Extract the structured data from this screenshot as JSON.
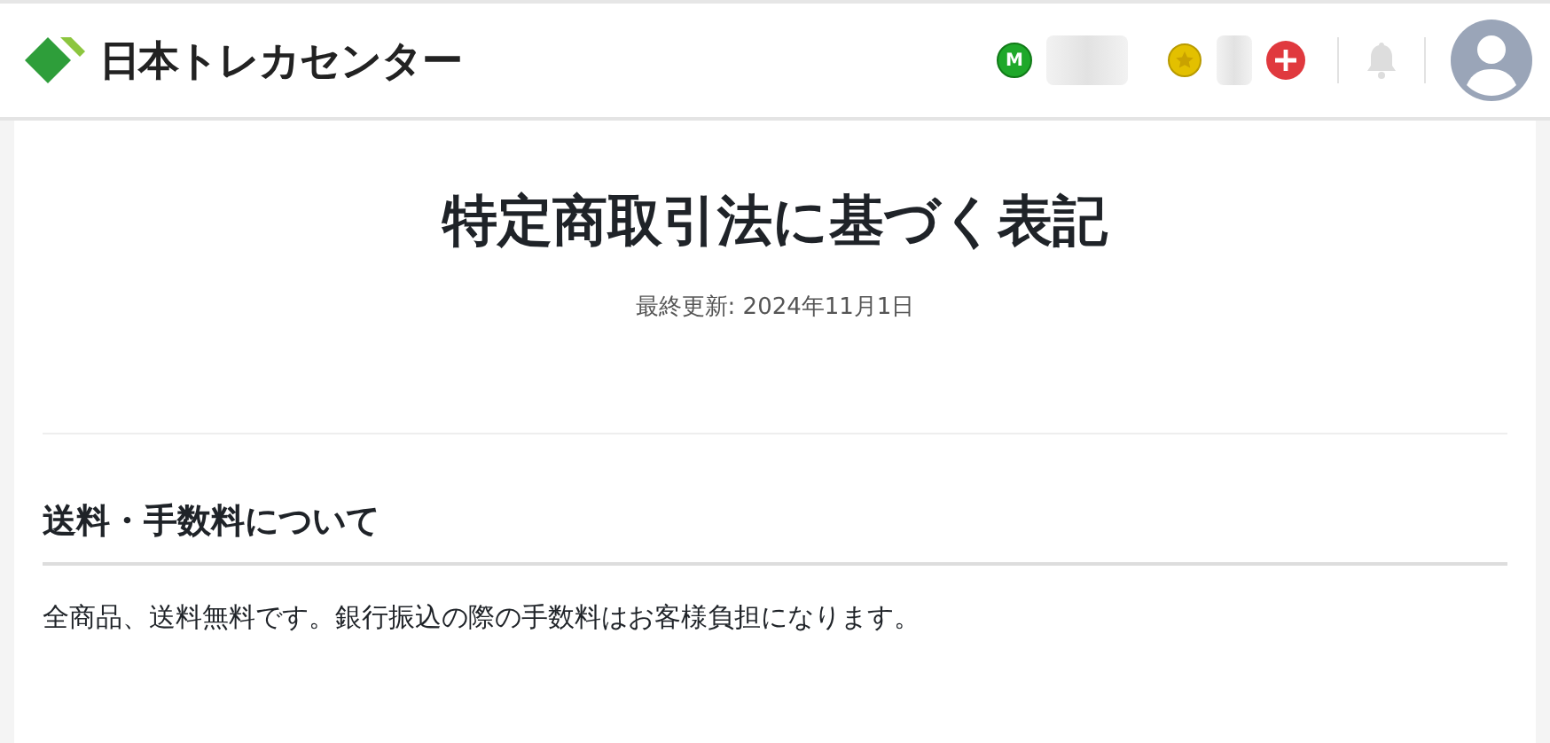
{
  "header": {
    "logo": "日本トレカセンター",
    "points_badge": "M"
  },
  "page": {
    "title": "特定商取引法に基づく表記",
    "updated": "最終更新: 2024年11月1日",
    "sections": [
      {
        "heading": "送料・手数料について",
        "body": "全商品、送料無料です。銀行振込の際の手数料はお客様負担になります。"
      }
    ]
  }
}
